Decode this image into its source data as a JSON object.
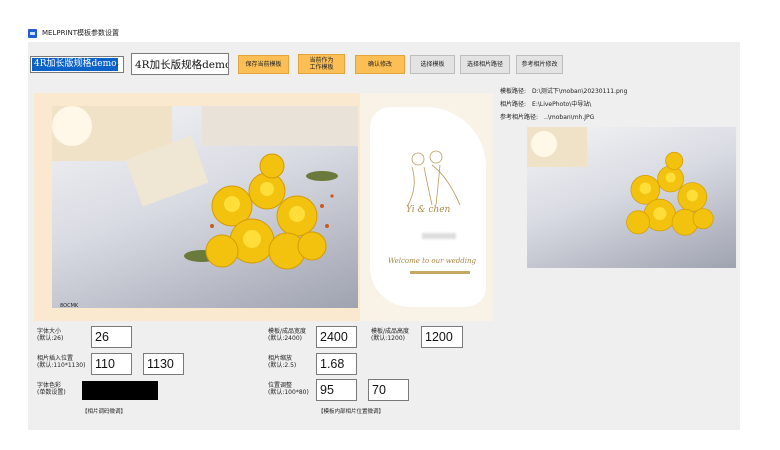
{
  "window": {
    "title": "MELPRINT模板参数设置"
  },
  "toolbar": {
    "template_select_value": "4R加长版规格demo",
    "template_name_value": "4R加长版规格demo",
    "buttons": [
      {
        "label": "保存当前模板",
        "style": "orange"
      },
      {
        "label": "当前作为\n工作模板",
        "style": "orange"
      },
      {
        "label": "确认修改",
        "style": "orange"
      },
      {
        "label": "选择模板",
        "style": "gray"
      },
      {
        "label": "选择相片路径",
        "style": "gray"
      },
      {
        "label": "参考相片修改",
        "style": "gray"
      }
    ]
  },
  "info": {
    "template_path_label": "模板路径:",
    "template_path_value": "D:\\测试下\\moban\\20230111.png",
    "photo_path_label": "相片路径:",
    "photo_path_value": "E:\\LivePhoto\\中导站\\",
    "reference_photo_label": "参考相片路径:",
    "reference_photo_value": "..\\moban\\mh.JPG"
  },
  "preview": {
    "stamp_text": "8OCMK",
    "card_names": "Yi & chen",
    "card_welcome": "Welcome to our wedding"
  },
  "fields": {
    "font_size_label": "字体大小\n(默认:26)",
    "font_size_value": "26",
    "photo_pos_label": "相片插入位置\n(默认:110*1130)",
    "photo_pos_x": "110",
    "photo_pos_y": "1130",
    "font_color_label": "字体色彩\n(单数设置)",
    "font_color_value": "#000000",
    "width_label": "模板/成品宽度\n(默认:2400)",
    "width_value": "2400",
    "height_label": "模板/成品高度\n(默认:1200)",
    "height_value": "1200",
    "scale_label": "相片缩放\n(默认:2.5)",
    "scale_value": "1.68",
    "offset_label": "位置调整\n(默认:100*80)",
    "offset_x": "95",
    "offset_y": "70",
    "fine_tune_link": "【相片调码微调】",
    "inner_pos_link": "【模板内部相片位置微调】"
  }
}
